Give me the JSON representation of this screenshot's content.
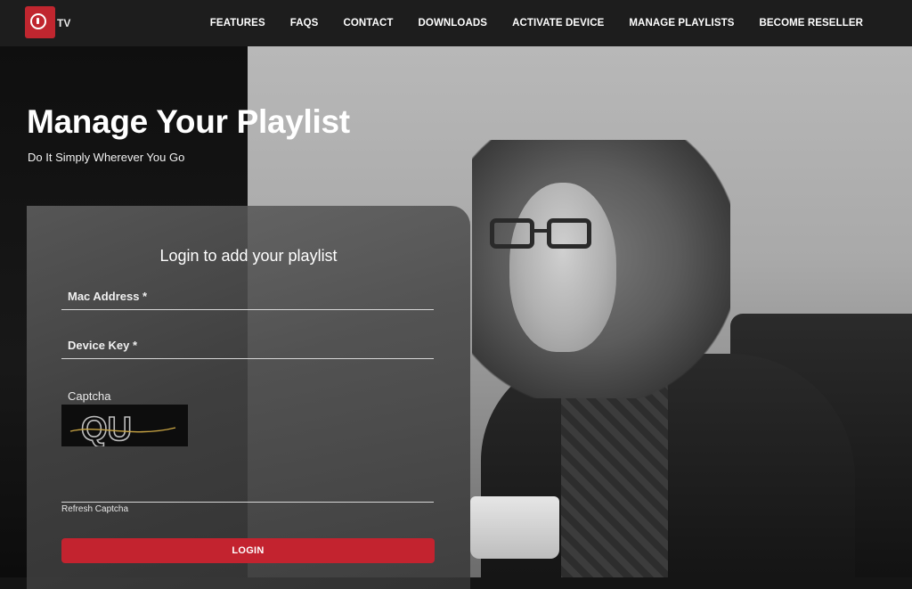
{
  "logo": {
    "text": "TV"
  },
  "nav": {
    "items": [
      {
        "label": "FEATURES"
      },
      {
        "label": "FAQS"
      },
      {
        "label": "CONTACT"
      },
      {
        "label": "DOWNLOADS"
      },
      {
        "label": "ACTIVATE DEVICE"
      },
      {
        "label": "MANAGE PLAYLISTS"
      },
      {
        "label": "BECOME RESELLER"
      }
    ]
  },
  "hero": {
    "title": "Manage Your Playlist",
    "subtitle": "Do It Simply Wherever You Go"
  },
  "login": {
    "title": "Login to add your playlist",
    "mac_placeholder": "Mac Address *",
    "device_key_placeholder": "Device Key *",
    "captcha_label": "Captcha",
    "captcha_text": "QU",
    "refresh_label": "Refresh Captcha",
    "button_label": "LOGIN"
  },
  "colors": {
    "accent": "#c3232f",
    "topbar": "#1d1d1d"
  },
  "icons": {
    "logo": "play-ring-logo-icon"
  }
}
